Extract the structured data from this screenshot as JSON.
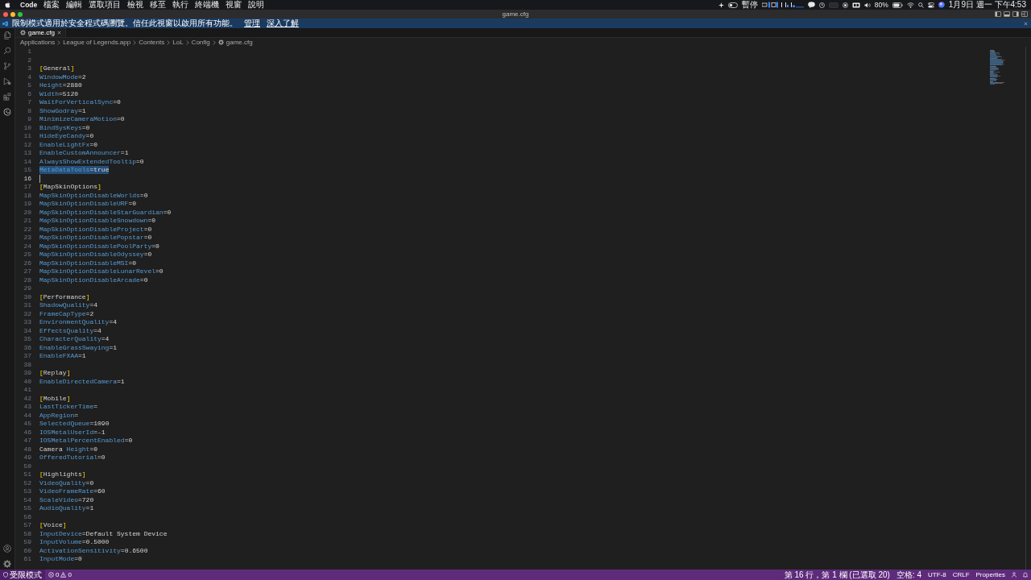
{
  "menu_bar": {
    "app": "Code",
    "items": [
      "檔案",
      "編輯",
      "選取項目",
      "檢視",
      "移至",
      "執行",
      "終端機",
      "視窗",
      "說明"
    ],
    "status": {
      "pause": "暫停",
      "battery": "80%",
      "clock": "1月9日 週一 下午4:53"
    }
  },
  "window": {
    "title": "game.cfg"
  },
  "banner": {
    "message": "限制模式適用於安全程式碼瀏覽。信任此視窗以啟用所有功能。",
    "links": [
      "管理",
      "深入了解"
    ]
  },
  "tabs": [
    {
      "label": "game.cfg",
      "selected": true
    }
  ],
  "breadcrumb": [
    "Applications",
    "League of Legends.app",
    "Contents",
    "LoL",
    "Config",
    "game.cfg"
  ],
  "editor": {
    "lines": [
      {
        "number": "1",
        "selected": false,
        "cursor": false
      },
      {
        "number": "2",
        "selected": false,
        "cursor": false
      },
      {
        "number": "3",
        "text": "[General]",
        "selected": false,
        "cursor": false
      },
      {
        "number": "4",
        "text": "WindowMode=2",
        "selected": false,
        "cursor": false
      },
      {
        "number": "5",
        "text": "Height=2880",
        "selected": false,
        "cursor": false
      },
      {
        "number": "6",
        "text": "Width=5120",
        "selected": false,
        "cursor": false
      },
      {
        "number": "7",
        "text": "WaitForVerticalSync=0",
        "selected": false,
        "cursor": false
      },
      {
        "number": "8",
        "text": "ShowGodray=1",
        "selected": false,
        "cursor": false
      },
      {
        "number": "9",
        "text": "MinimizeCameraMotion=0",
        "selected": false,
        "cursor": false
      },
      {
        "number": "10",
        "text": "BindSysKeys=0",
        "selected": false,
        "cursor": false
      },
      {
        "number": "11",
        "text": "HideEyeCandy=0",
        "selected": false,
        "cursor": false
      },
      {
        "number": "12",
        "text": "EnableLightFx=0",
        "selected": false,
        "cursor": false
      },
      {
        "number": "13",
        "text": "EnableCustomAnnouncer=1",
        "selected": false,
        "cursor": false
      },
      {
        "number": "14",
        "text": "AlwaysShowExtendedTooltip=0",
        "selected": false,
        "cursor": false
      },
      {
        "number": "15",
        "text": "MetaDataTools=true",
        "selected": true,
        "cursor": false
      },
      {
        "number": "16",
        "selected": false,
        "cursor": true
      },
      {
        "number": "17",
        "text": "[MapSkinOptions]",
        "selected": false,
        "cursor": false
      },
      {
        "number": "18",
        "text": "MapSkinOptionDisableWorlds=0",
        "selected": false,
        "cursor": false
      },
      {
        "number": "19",
        "text": "MapSkinOptionDisableURF=0",
        "selected": false,
        "cursor": false
      },
      {
        "number": "20",
        "text": "MapSkinOptionDisableStarGuardian=0",
        "selected": false,
        "cursor": false
      },
      {
        "number": "21",
        "text": "MapSkinOptionDisableSnowdown=0",
        "selected": false,
        "cursor": false
      },
      {
        "number": "22",
        "text": "MapSkinOptionDisableProject=0",
        "selected": false,
        "cursor": false
      },
      {
        "number": "23",
        "text": "MapSkinOptionDisablePopstar=0",
        "selected": false,
        "cursor": false
      },
      {
        "number": "24",
        "text": "MapSkinOptionDisablePoolParty=0",
        "selected": false,
        "cursor": false
      },
      {
        "number": "25",
        "text": "MapSkinOptionDisableOdyssey=0",
        "selected": false,
        "cursor": false
      },
      {
        "number": "26",
        "text": "MapSkinOptionDisableMSI=0",
        "selected": false,
        "cursor": false
      },
      {
        "number": "27",
        "text": "MapSkinOptionDisableLunarRevel=0",
        "selected": false,
        "cursor": false
      },
      {
        "number": "28",
        "text": "MapSkinOptionDisableArcade=0",
        "selected": false,
        "cursor": false
      },
      {
        "number": "29",
        "selected": false,
        "cursor": false
      },
      {
        "number": "30",
        "text": "[Performance]",
        "selected": false,
        "cursor": false
      },
      {
        "number": "31",
        "text": "ShadowQuality=4",
        "selected": false,
        "cursor": false
      },
      {
        "number": "32",
        "text": "FrameCapType=2",
        "selected": false,
        "cursor": false
      },
      {
        "number": "33",
        "text": "EnvironmentQuality=4",
        "selected": false,
        "cursor": false
      },
      {
        "number": "34",
        "text": "EffectsQuality=4",
        "selected": false,
        "cursor": false
      },
      {
        "number": "35",
        "text": "CharacterQuality=4",
        "selected": false,
        "cursor": false
      },
      {
        "number": "36",
        "text": "EnableGrassSwaying=1",
        "selected": false,
        "cursor": false
      },
      {
        "number": "37",
        "text": "EnableFXAA=1",
        "selected": false,
        "cursor": false
      },
      {
        "number": "38",
        "selected": false,
        "cursor": false
      },
      {
        "number": "39",
        "text": "[Replay]",
        "selected": false,
        "cursor": false
      },
      {
        "number": "40",
        "text": "EnableDirectedCamera=1",
        "selected": false,
        "cursor": false
      },
      {
        "number": "41",
        "selected": false,
        "cursor": false
      },
      {
        "number": "42",
        "text": "[Mobile]",
        "selected": false,
        "cursor": false
      },
      {
        "number": "43",
        "text": "LastTickerTime=",
        "selected": false,
        "cursor": false
      },
      {
        "number": "44",
        "text": "AppRegion=",
        "selected": false,
        "cursor": false
      },
      {
        "number": "45",
        "text": "SelectedQueue=1090",
        "selected": false,
        "cursor": false
      },
      {
        "number": "46",
        "text": "IOSMetalUserId=-1",
        "selected": false,
        "cursor": false
      },
      {
        "number": "47",
        "text": "IOSMetalPercentEnabled=0",
        "selected": false,
        "cursor": false
      },
      {
        "number": "48",
        "text": "Camera Height=0",
        "selected": false,
        "cursor": false
      },
      {
        "number": "49",
        "text": "OfferedTutorial=0",
        "selected": false,
        "cursor": false
      },
      {
        "number": "50",
        "selected": false,
        "cursor": false
      },
      {
        "number": "51",
        "text": "[Highlights]",
        "selected": false,
        "cursor": false
      },
      {
        "number": "52",
        "text": "VideoQuality=0",
        "selected": false,
        "cursor": false
      },
      {
        "number": "53",
        "text": "VideoFrameRate=60",
        "selected": false,
        "cursor": false
      },
      {
        "number": "54",
        "text": "ScaleVideo=720",
        "selected": false,
        "cursor": false
      },
      {
        "number": "55",
        "text": "AudioQuality=1",
        "selected": false,
        "cursor": false
      },
      {
        "number": "56",
        "selected": false,
        "cursor": false
      },
      {
        "number": "57",
        "text": "[Voice]",
        "selected": false,
        "cursor": false
      },
      {
        "number": "58",
        "text": "InputDevice=Default System Device",
        "selected": false,
        "cursor": false
      },
      {
        "number": "59",
        "text": "InputVolume=0.5000",
        "selected": false,
        "cursor": false
      },
      {
        "number": "60",
        "text": "ActivationSensitivity=0.6500",
        "selected": false,
        "cursor": false
      },
      {
        "number": "61",
        "text": "InputMode=0",
        "selected": false,
        "cursor": false
      }
    ]
  },
  "status_bar": {
    "mode": "受限模式",
    "errors": "0",
    "warnings": "0",
    "position": "第 16 行，第 1 欄 (已選取 20)",
    "indentation": "空格: 4",
    "encoding": "UTF-8",
    "line_ending": "CRLF",
    "language": "Properties"
  }
}
